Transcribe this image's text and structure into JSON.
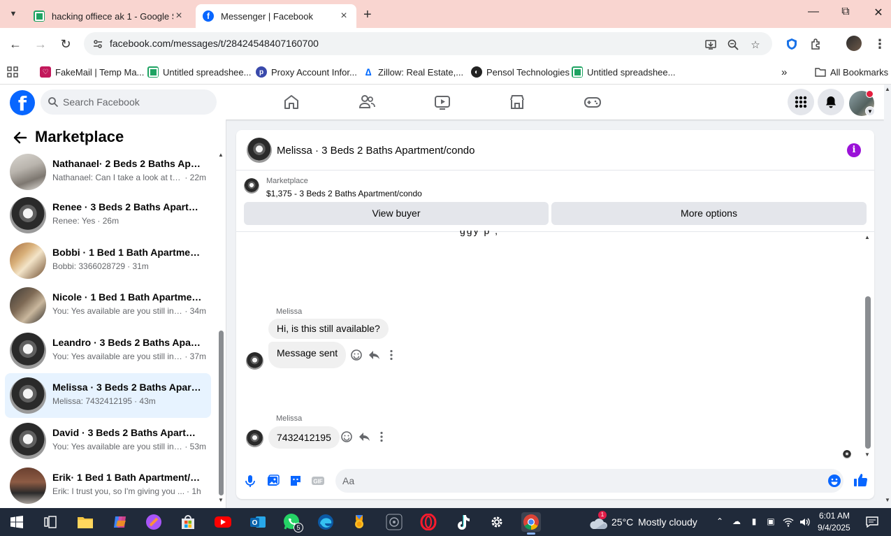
{
  "browser": {
    "tabs": [
      {
        "title": "hacking offiece ak 1 - Google Sh",
        "active": false
      },
      {
        "title": "Messenger | Facebook",
        "active": true
      }
    ],
    "url": "facebook.com/messages/t/28424548407160700",
    "bookmarks": [
      {
        "label": "FakeMail | Temp Ma..."
      },
      {
        "label": "Untitled spreadshee..."
      },
      {
        "label": "Proxy Account Infor..."
      },
      {
        "label": "Zillow: Real Estate,..."
      },
      {
        "label": "Pensol Technologies"
      },
      {
        "label": "Untitled spreadshee..."
      }
    ],
    "all_bookmarks": "All Bookmarks"
  },
  "facebook": {
    "logo": "f",
    "search_placeholder": "Search Facebook",
    "nav_icons": [
      "home-icon",
      "friends-icon",
      "watch-icon",
      "marketplace-icon",
      "gaming-icon"
    ]
  },
  "sidebar": {
    "title": "Marketplace",
    "conversations": [
      {
        "name": "Nathanael· 2 Beds 2 Baths Apart...",
        "preview": "Nathanael: Can I take a look at th...",
        "time": "· 22m",
        "selected": false
      },
      {
        "name": "Renee · 3 Beds 2 Baths Apartme...",
        "preview": "Renee: Yes",
        "time": "· 26m",
        "selected": false
      },
      {
        "name": "Bobbi · 1 Bed 1 Bath Apartment/...",
        "preview": "Bobbi: 3366028729",
        "time": "· 31m",
        "selected": false
      },
      {
        "name": "Nicole · 1 Bed 1 Bath Apartment...",
        "preview": "You: Yes available are you still int...",
        "time": "· 34m",
        "selected": false
      },
      {
        "name": "Leandro · 3 Beds 2 Baths Apart...",
        "preview": "You: Yes available are you still int...",
        "time": "· 37m",
        "selected": false
      },
      {
        "name": "Melissa · 3 Beds 2 Baths Apartm...",
        "preview": "Melissa: 7432412195",
        "time": "· 43m",
        "selected": true
      },
      {
        "name": "David · 3 Beds 2 Baths Apartme...",
        "preview": "You: Yes available are you still int...",
        "time": "· 53m",
        "selected": false
      },
      {
        "name": "Erik· 1 Bed 1 Bath Apartment/co...",
        "preview": "Erik: I trust you, so I'm giving you ...",
        "time": "· 1h",
        "selected": false
      }
    ]
  },
  "chat": {
    "title": "Melissa · 3 Beds 2 Baths Apartment/condo",
    "listing_category": "Marketplace",
    "listing_price": "$1,375 - 3 Beds 2 Baths Apartment/condo",
    "view_buyer": "View buyer",
    "more_options": "More options",
    "cut_text": "ggy                 p        ,",
    "messages": [
      {
        "sender": "Melissa",
        "bubbles": [
          "Hi, is this still available?",
          "Message sent"
        ]
      },
      {
        "sender": "Melissa",
        "bubbles": [
          "7432412195"
        ]
      }
    ],
    "composer_placeholder": "Aa"
  },
  "taskbar": {
    "weather_temp": "25°C",
    "weather_desc": "Mostly cloudy",
    "time": "6:01 AM",
    "date": "9/4/2025",
    "whatsapp_badge": "5",
    "weather_badge": "1"
  },
  "colors": {
    "fb_blue": "#0866ff",
    "selected_bg": "#e7f3ff",
    "tabstrip": "#f9d5d0",
    "taskbar": "#202a3a",
    "info_purple": "#9b12d8"
  }
}
